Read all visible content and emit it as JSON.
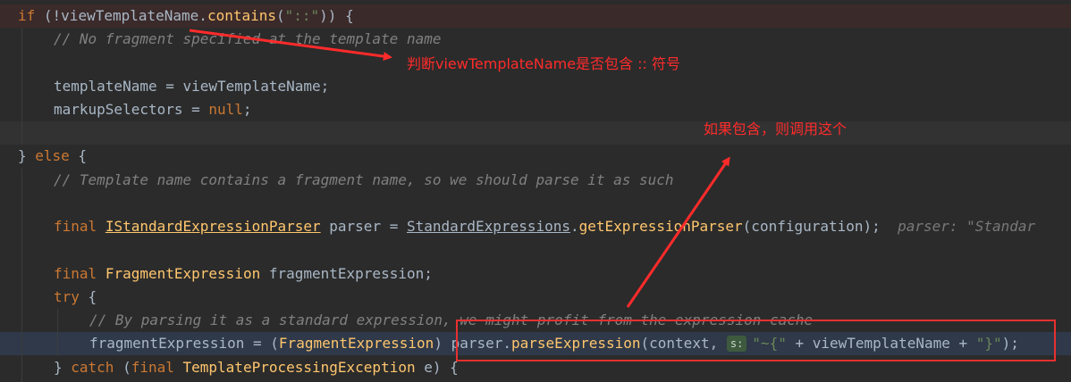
{
  "code_lines": {
    "l1": {
      "kw_if": "if",
      "p1": " (!",
      "var": "viewTemplateName",
      "dot": ".",
      "fn": "contains",
      "p2": "(",
      "str": "\"::\"",
      "p3": ")) {"
    },
    "l2": {
      "comment": "// No fragment specified at the template name"
    },
    "l4": {
      "lhs": "templateName = viewTemplateName;"
    },
    "l5": {
      "lhs": "markupSelectors = ",
      "kw": "null",
      "semi": ";"
    },
    "l7": {
      "brace": "} ",
      "kw_else": "else",
      "rest": " {"
    },
    "l8": {
      "comment": "// Template name contains a fragment name, so we should parse it as such"
    },
    "l10": {
      "kw_final": "final",
      "type": "IStandardExpressionParser",
      "var": " parser = ",
      "cls": "StandardExpressions",
      "dot": ".",
      "fn": "getExpressionParser",
      "args": "(configuration);",
      "hint": "parser: \"Standar"
    },
    "l12": {
      "kw_final": "final",
      "type": "FragmentExpression",
      "rest": " fragmentExpression;"
    },
    "l13": {
      "kw_try": "try",
      "rest": " {"
    },
    "l14": {
      "comment": "// By parsing it as a standard expression, we might profit from the expression cache"
    },
    "l15": {
      "lhs": "fragmentExpression = (",
      "cast": "FragmentExpression",
      "mid": ") ",
      "obj": "parser",
      "dot": ".",
      "fn": "parseExpression",
      "args1": "(context, ",
      "badge": "s:",
      "str1": "\"~{\"",
      "plus1": " + viewTemplateName + ",
      "str2": "\"}\"",
      "end": ");"
    },
    "l16": {
      "brace": "} ",
      "kw_catch": "catch",
      "p1": " (",
      "kw_final": "final",
      "type": " TemplateProcessingException",
      "rest": " e) {"
    }
  },
  "annotations": {
    "a1": "判断viewTemplateName是否包含 :: 符号",
    "a2": "如果包含，则调用这个"
  },
  "colors": {
    "annotation": "#ff2b2b",
    "keyword": "#cc7832",
    "function": "#ffc66d",
    "string": "#6a8759",
    "comment": "#808080"
  }
}
